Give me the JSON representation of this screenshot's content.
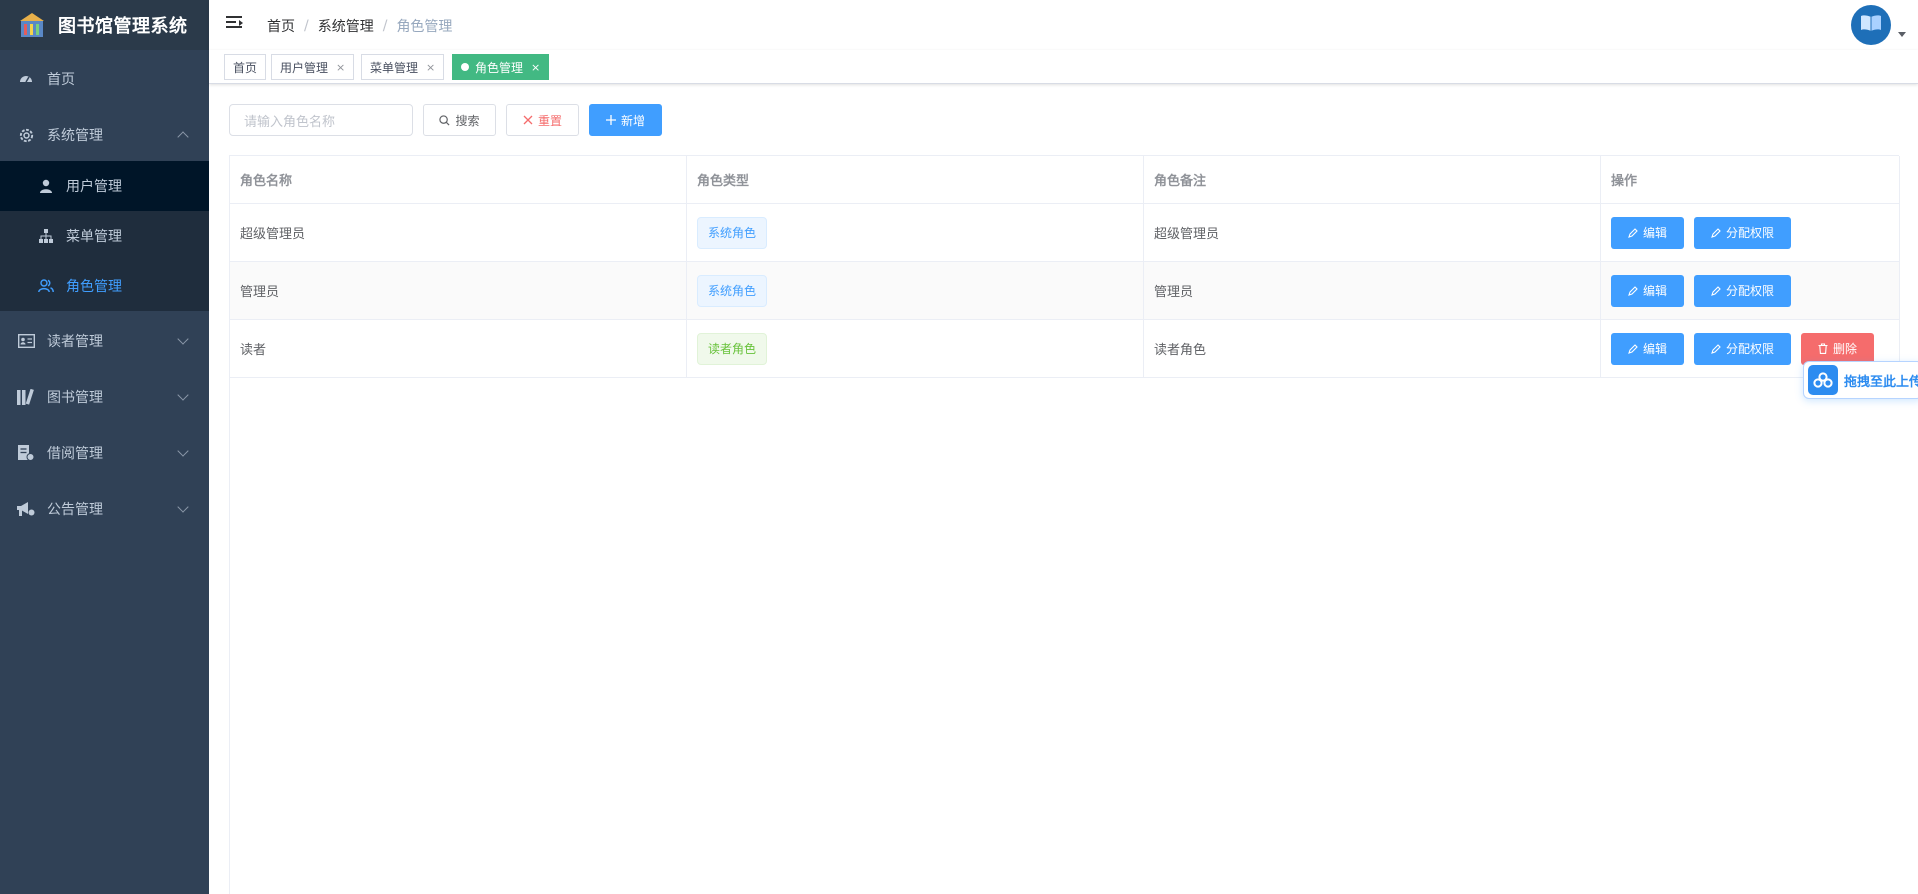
{
  "app": {
    "title": "图书馆管理系统"
  },
  "sidebar": {
    "items": [
      {
        "label": "首页",
        "icon": "dashboard-icon"
      },
      {
        "label": "系统管理",
        "icon": "gear-icon",
        "expanded": true,
        "children": [
          {
            "label": "用户管理",
            "icon": "user-icon"
          },
          {
            "label": "菜单管理",
            "icon": "tree-icon"
          },
          {
            "label": "角色管理",
            "icon": "people-icon",
            "active": true
          }
        ]
      },
      {
        "label": "读者管理",
        "icon": "id-card-icon"
      },
      {
        "label": "图书管理",
        "icon": "books-icon"
      },
      {
        "label": "借阅管理",
        "icon": "borrow-icon"
      },
      {
        "label": "公告管理",
        "icon": "megaphone-icon"
      }
    ]
  },
  "header": {
    "breadcrumb": [
      "首页",
      "系统管理",
      "角色管理"
    ],
    "separator": "/"
  },
  "tags": [
    {
      "label": "首页",
      "closable": false
    },
    {
      "label": "用户管理",
      "closable": true
    },
    {
      "label": "菜单管理",
      "closable": true
    },
    {
      "label": "角色管理",
      "closable": true,
      "active": true
    }
  ],
  "tag_close": "×",
  "toolbar": {
    "search_placeholder": "请输入角色名称",
    "search_label": "搜索",
    "reset_label": "重置",
    "add_label": "新增"
  },
  "table": {
    "columns": [
      "角色名称",
      "角色类型",
      "角色备注",
      "操作"
    ],
    "rows": [
      {
        "name": "超级管理员",
        "type": "系统角色",
        "type_style": "sys",
        "remark": "超级管理员",
        "deletable": false
      },
      {
        "name": "管理员",
        "type": "系统角色",
        "type_style": "sys",
        "remark": "管理员",
        "deletable": false
      },
      {
        "name": "读者",
        "type": "读者角色",
        "type_style": "reader",
        "remark": "读者角色",
        "deletable": true
      }
    ],
    "actions": {
      "edit": "编辑",
      "permission": "分配权限",
      "delete": "删除"
    }
  },
  "upload_widget": {
    "label": "拖拽至此上传"
  },
  "colors": {
    "sidebar_bg": "#304156",
    "primary": "#409eff",
    "danger": "#f56c6c",
    "success": "#67c23a",
    "active_tag": "#42b983"
  }
}
